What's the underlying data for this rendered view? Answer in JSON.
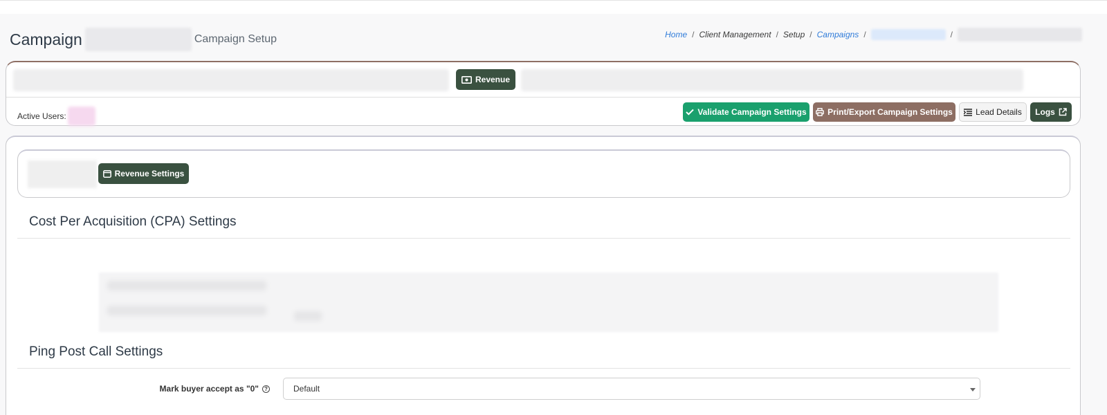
{
  "header": {
    "title": "Campaign",
    "subtitle": "Campaign Setup"
  },
  "breadcrumb": {
    "home": "Home",
    "client_management": "Client Management",
    "setup": "Setup",
    "campaigns": "Campaigns",
    "sep": "/"
  },
  "tabs": {
    "active_label": "Revenue"
  },
  "status": {
    "active_users_label": "Active Users:"
  },
  "actions": {
    "validate": "Validate Campaign Settings",
    "print": "Print/Export Campaign Settings",
    "lead_details": "Lead Details",
    "logs": "Logs"
  },
  "subnav": {
    "revenue_settings": "Revenue Settings"
  },
  "sections": {
    "cpa_title": "Cost Per Acquisition (CPA) Settings",
    "ppc_title": "Ping Post Call Settings"
  },
  "form": {
    "mark_buyer_label": "Mark buyer accept as \"0\"",
    "mark_buyer_value": "Default"
  },
  "colors": {
    "accent_dark": "#3a5140",
    "validate_green": "#1aa06d",
    "print_brown": "#8d6e63",
    "link_blue": "#2f7bd9"
  }
}
